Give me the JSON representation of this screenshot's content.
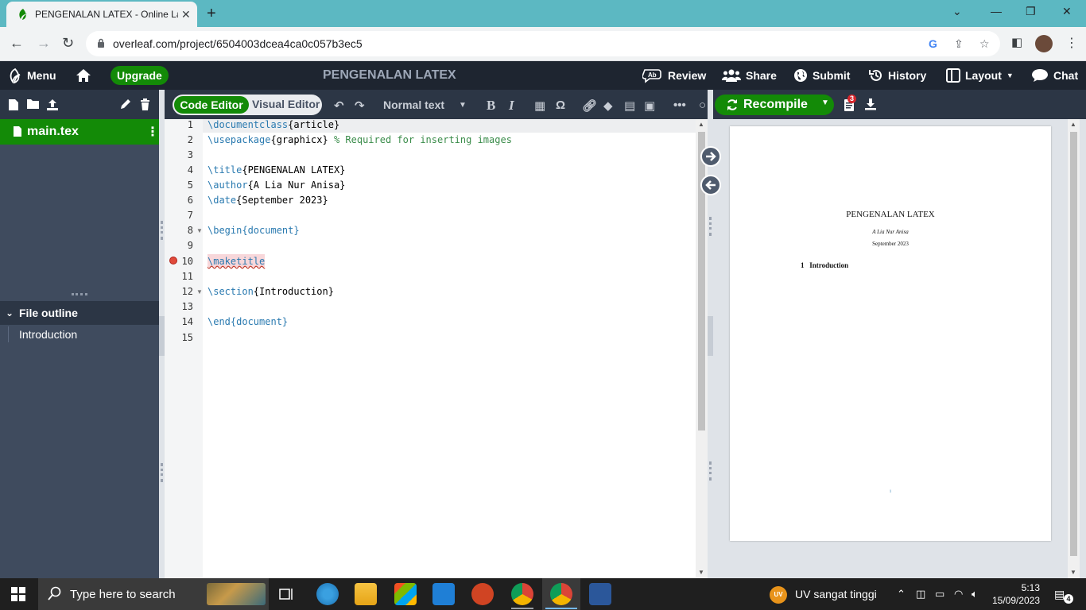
{
  "browser": {
    "tab_title": "PENGENALAN LATEX - Online La",
    "url": "overleaf.com/project/6504003dcea4ca0c057b3ec5"
  },
  "header": {
    "menu_label": "Menu",
    "upgrade_label": "Upgrade",
    "project_title": "PENGENALAN LATEX",
    "review_label": "Review",
    "share_label": "Share",
    "submit_label": "Submit",
    "history_label": "History",
    "layout_label": "Layout",
    "chat_label": "Chat"
  },
  "filetree": {
    "file_name": "main.tex",
    "outline_heading": "File outline",
    "outline_items": [
      "Introduction"
    ]
  },
  "editor": {
    "code_editor_label": "Code Editor",
    "visual_editor_label": "Visual Editor",
    "style_select": "Normal text",
    "bold_label": "B",
    "italic_label": "I",
    "omega_label": "Ω",
    "lines": [
      {
        "n": "1",
        "cmd": "\\documentclass",
        "arg": "{article}",
        "rest": ""
      },
      {
        "n": "2",
        "cmd": "\\usepackage",
        "arg": "{graphicx}",
        "rest": " % Required for inserting images"
      },
      {
        "n": "3",
        "cmd": "",
        "arg": "",
        "rest": ""
      },
      {
        "n": "4",
        "cmd": "\\title",
        "arg": "{PENGENALAN LATEX}",
        "rest": ""
      },
      {
        "n": "5",
        "cmd": "\\author",
        "arg": "{A Lia Nur Anisa}",
        "rest": ""
      },
      {
        "n": "6",
        "cmd": "\\date",
        "arg": "{September 2023}",
        "rest": ""
      },
      {
        "n": "7",
        "cmd": "",
        "arg": "",
        "rest": ""
      },
      {
        "n": "8",
        "cmd": "\\begin",
        "arg": "{document}",
        "rest": ""
      },
      {
        "n": "9",
        "cmd": "",
        "arg": "",
        "rest": ""
      },
      {
        "n": "10",
        "cmd": "\\maketitle",
        "arg": "",
        "rest": ""
      },
      {
        "n": "11",
        "cmd": "",
        "arg": "",
        "rest": ""
      },
      {
        "n": "12",
        "cmd": "\\section",
        "arg": "{Introduction}",
        "rest": ""
      },
      {
        "n": "13",
        "cmd": "",
        "arg": "",
        "rest": ""
      },
      {
        "n": "14",
        "cmd": "\\end",
        "arg": "{document}",
        "rest": ""
      },
      {
        "n": "15",
        "cmd": "",
        "arg": "",
        "rest": ""
      }
    ]
  },
  "preview": {
    "recompile_label": "Recompile",
    "logs_badge": "3",
    "doc_title": "PENGENALAN LATEX",
    "doc_author": "A Lia Nur Anisa",
    "doc_date": "September 2023",
    "section_number": "1",
    "section_title": "Introduction",
    "page_number": "1"
  },
  "taskbar": {
    "search_placeholder": "Type here to search",
    "uv_badge": "UV",
    "uv_text": "UV sangat tinggi",
    "time": "5:13",
    "date": "15/09/2023",
    "notifications": "4"
  },
  "colors": {
    "overleaf_green": "#138a07",
    "header_bg": "#1e2530",
    "sidebar_bg": "#3f4b5e",
    "tab_strip": "#5cb8c2"
  }
}
